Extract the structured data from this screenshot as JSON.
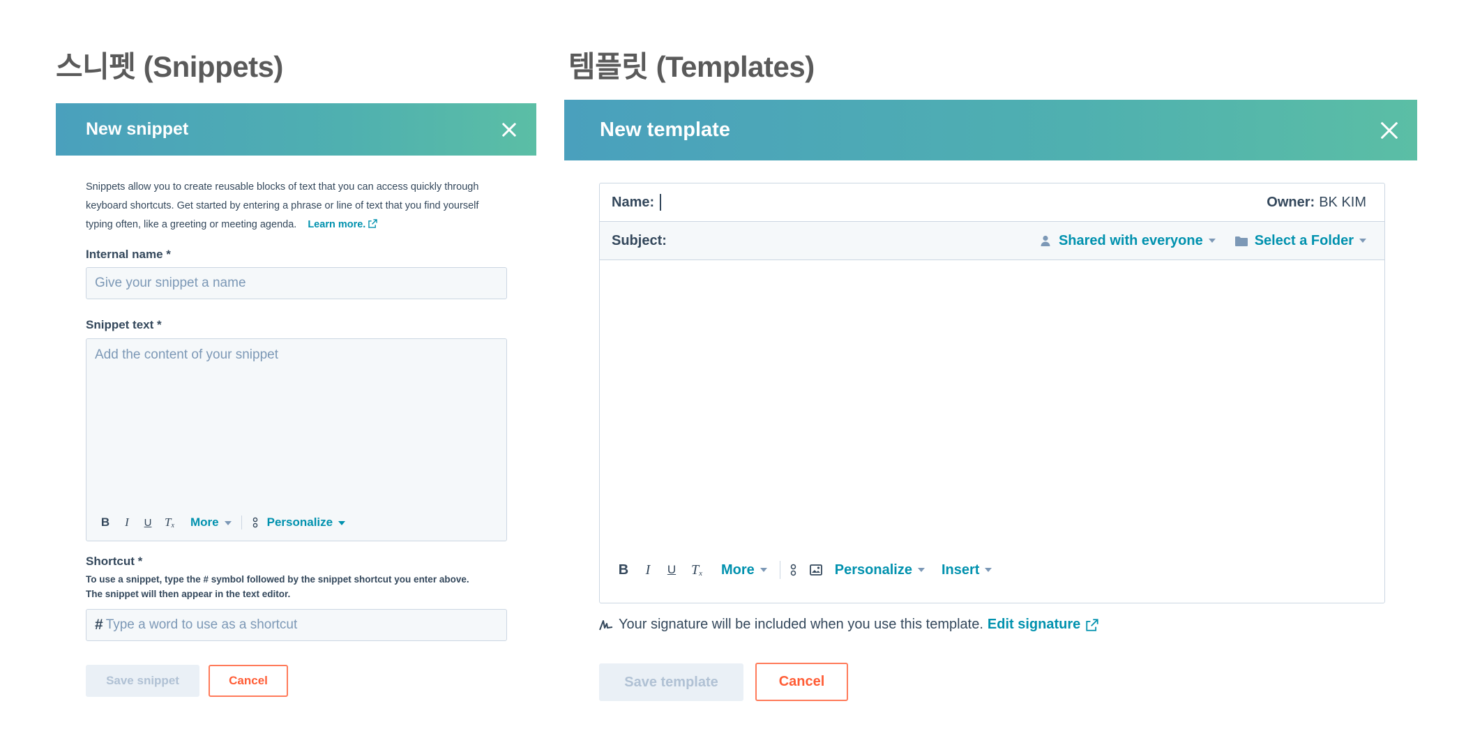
{
  "snippets_section": {
    "title": "스니펫 (Snippets)",
    "dialog_title": "New snippet",
    "intro_line1": "Snippets allow you to create reusable blocks of text that you can access quickly through",
    "intro_line2": "keyboard shortcuts. Get started by entering a phrase or line of text that you find yourself",
    "intro_line3": "typing often, like a greeting or meeting agenda.",
    "learn_more": "Learn more.",
    "internal_name_label": "Internal name *",
    "internal_name_placeholder": "Give your snippet a name",
    "snippet_text_label": "Snippet text *",
    "snippet_text_placeholder": "Add the content of your snippet",
    "toolbar": {
      "bold": "B",
      "italic": "I",
      "underline": "U",
      "clear_format": "T",
      "more": "More",
      "personalize": "Personalize"
    },
    "shortcut_label": "Shortcut *",
    "shortcut_help1": "To use a snippet, type the # symbol followed by the snippet shortcut you enter above.",
    "shortcut_help2": "The snippet will then appear in the text editor.",
    "shortcut_prefix": "#",
    "shortcut_placeholder": "Type a word to use as a shortcut",
    "save_button": "Save snippet",
    "cancel_button": "Cancel"
  },
  "templates_section": {
    "title": "템플릿 (Templates)",
    "dialog_title": "New template",
    "name_label": "Name:",
    "owner_label": "Owner:",
    "owner_value": "BK KIM",
    "subject_label": "Subject:",
    "shared_with": "Shared with everyone",
    "select_folder": "Select a Folder",
    "toolbar": {
      "bold": "B",
      "italic": "I",
      "underline": "U",
      "clear_format": "T",
      "more": "More",
      "personalize": "Personalize",
      "insert": "Insert"
    },
    "signature_text": "Your signature will be included when you use this template.",
    "edit_signature": "Edit signature",
    "save_button": "Save template",
    "cancel_button": "Cancel"
  },
  "colors": {
    "accent_link": "#0091ae",
    "cancel_orange": "#ff5c35",
    "header_gradient_start": "#4aa0bd",
    "header_gradient_end": "#5bbea5"
  }
}
